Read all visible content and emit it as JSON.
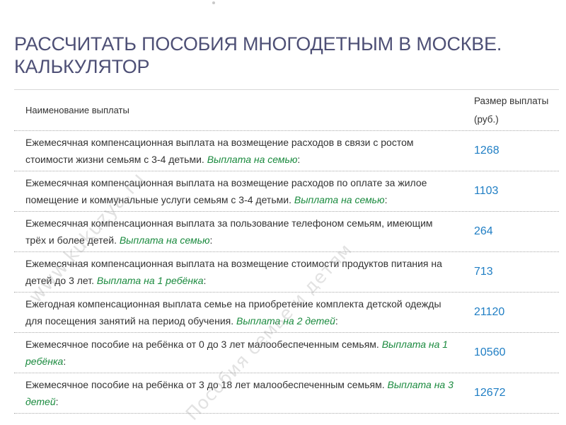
{
  "page": {
    "title": "РАССЧИТАТЬ ПОСОБИЯ МНОГОДЕТНЫМ В МОСКВЕ. КАЛЬКУЛЯТОР"
  },
  "table": {
    "header": {
      "name": "Наименование выплаты",
      "value": "Размер выплаты (руб.)"
    },
    "rows": [
      {
        "text": "Ежемесячная компенсационная выплата на возмещение расходов в связи с ростом стоимости жизни семьям с 3-4 детьми.",
        "payee": "Выплата на семью",
        "suffix": ":",
        "amount": "1268"
      },
      {
        "text": "Ежемесячная компенсационная выплата на возмещение расходов по оплате за жилое помещение и коммунальные услуги семьям с 3-4 детьми.",
        "payee": "Выплата на семью",
        "suffix": ":",
        "amount": "1103"
      },
      {
        "text": "Ежемесячная компенсационная выплата за пользование телефоном семьям, имеющим трёх и более детей.",
        "payee": "Выплата на семью",
        "suffix": ":",
        "amount": "264"
      },
      {
        "text": "Ежемесячная компенсационная выплата на возмещение стоимости продуктов питания на детей до 3 лет.",
        "payee": "Выплата на 1 ребёнка",
        "suffix": ":",
        "amount": "713"
      },
      {
        "text": "Ежегодная компенсационная выплата семье на приобретение комплекта детской одежды для посещения занятий на период обучения.",
        "payee": "Выплата на 2 детей",
        "suffix": ":",
        "amount": "21120"
      },
      {
        "text": "Ежемесячное пособие на ребёнка от 0 до 3 лет малообеспеченным семьям.",
        "payee": "Выплата на 1 ребёнка",
        "suffix": ":",
        "amount": "10560"
      },
      {
        "text": "Ежемесячное пособие на ребёнка от 3 до 18 лет малообеспеченным семьям.",
        "payee": "Выплата на 3 детей",
        "suffix": ":",
        "amount": "12672"
      }
    ]
  },
  "watermarks": {
    "site": "www.kukuzya.ru",
    "tagline": "Пособия семье и детям"
  }
}
